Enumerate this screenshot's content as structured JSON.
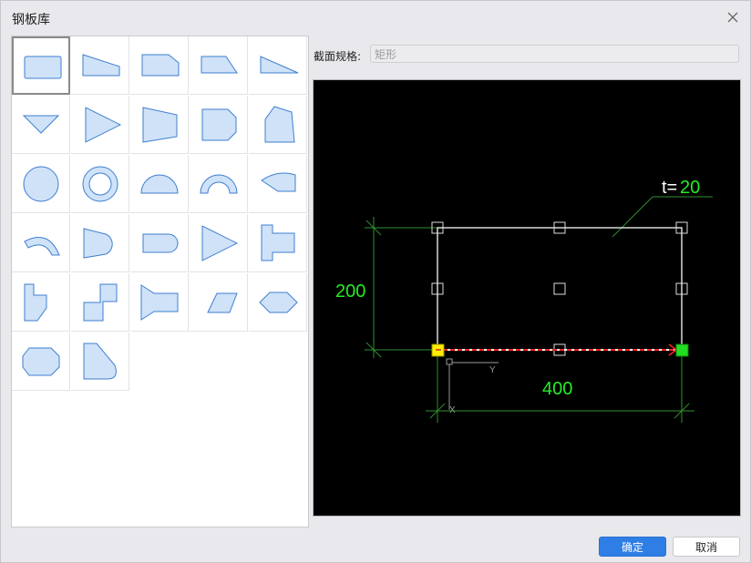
{
  "dialog": {
    "title": "钢板库",
    "close_icon": "close-icon"
  },
  "spec": {
    "label": "截面规格:",
    "value": "矩形"
  },
  "preview": {
    "thickness_prefix": "t=",
    "thickness_value": "20",
    "height_value": "200",
    "width_value": "400",
    "axis_y": "Y",
    "axis_x": "X",
    "colors": {
      "background": "#000000",
      "outline": "#ffffff",
      "dimension": "#2fbf2f",
      "dimension_text": "#22ee22",
      "handle_start": "#ffee00",
      "handle_end": "#22dd22",
      "arrow_red": "#ff2020"
    }
  },
  "gallery": {
    "shapes": [
      "rectangle",
      "trapezoid-right-slope",
      "chamfered-rectangle",
      "triangle-wedge",
      "thin-wedge",
      "inverted-triangle",
      "right-triangle",
      "trapezoid",
      "d-shape",
      "pentagon",
      "circle",
      "ring",
      "semicircle",
      "arch",
      "fan-segment",
      "curved-arc",
      "bullet-shape",
      "rounded-rectangle",
      "triangle",
      "t-shape",
      "l-shape",
      "z-shape",
      "flange-shape",
      "parallelogram",
      "hexagon",
      "octagon",
      "rounded-corner-rectangle"
    ],
    "selected_index": 0,
    "fill": "#cfe2f8",
    "stroke": "#3f7fcf"
  },
  "buttons": {
    "ok": "确定",
    "cancel": "取消",
    "primary_color": "#2f7ee6"
  }
}
